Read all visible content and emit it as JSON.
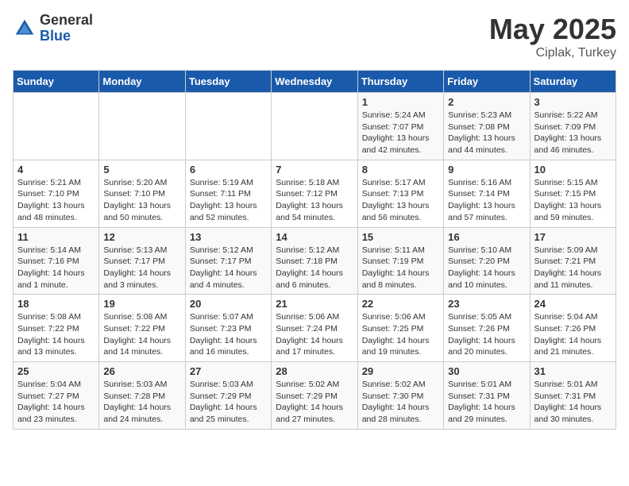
{
  "header": {
    "logo_general": "General",
    "logo_blue": "Blue",
    "title": "May 2025",
    "location": "Ciplak, Turkey"
  },
  "days_of_week": [
    "Sunday",
    "Monday",
    "Tuesday",
    "Wednesday",
    "Thursday",
    "Friday",
    "Saturday"
  ],
  "weeks": [
    [
      {
        "day": "",
        "info": ""
      },
      {
        "day": "",
        "info": ""
      },
      {
        "day": "",
        "info": ""
      },
      {
        "day": "",
        "info": ""
      },
      {
        "day": "1",
        "info": "Sunrise: 5:24 AM\nSunset: 7:07 PM\nDaylight: 13 hours\nand 42 minutes."
      },
      {
        "day": "2",
        "info": "Sunrise: 5:23 AM\nSunset: 7:08 PM\nDaylight: 13 hours\nand 44 minutes."
      },
      {
        "day": "3",
        "info": "Sunrise: 5:22 AM\nSunset: 7:09 PM\nDaylight: 13 hours\nand 46 minutes."
      }
    ],
    [
      {
        "day": "4",
        "info": "Sunrise: 5:21 AM\nSunset: 7:10 PM\nDaylight: 13 hours\nand 48 minutes."
      },
      {
        "day": "5",
        "info": "Sunrise: 5:20 AM\nSunset: 7:10 PM\nDaylight: 13 hours\nand 50 minutes."
      },
      {
        "day": "6",
        "info": "Sunrise: 5:19 AM\nSunset: 7:11 PM\nDaylight: 13 hours\nand 52 minutes."
      },
      {
        "day": "7",
        "info": "Sunrise: 5:18 AM\nSunset: 7:12 PM\nDaylight: 13 hours\nand 54 minutes."
      },
      {
        "day": "8",
        "info": "Sunrise: 5:17 AM\nSunset: 7:13 PM\nDaylight: 13 hours\nand 56 minutes."
      },
      {
        "day": "9",
        "info": "Sunrise: 5:16 AM\nSunset: 7:14 PM\nDaylight: 13 hours\nand 57 minutes."
      },
      {
        "day": "10",
        "info": "Sunrise: 5:15 AM\nSunset: 7:15 PM\nDaylight: 13 hours\nand 59 minutes."
      }
    ],
    [
      {
        "day": "11",
        "info": "Sunrise: 5:14 AM\nSunset: 7:16 PM\nDaylight: 14 hours\nand 1 minute."
      },
      {
        "day": "12",
        "info": "Sunrise: 5:13 AM\nSunset: 7:17 PM\nDaylight: 14 hours\nand 3 minutes."
      },
      {
        "day": "13",
        "info": "Sunrise: 5:12 AM\nSunset: 7:17 PM\nDaylight: 14 hours\nand 4 minutes."
      },
      {
        "day": "14",
        "info": "Sunrise: 5:12 AM\nSunset: 7:18 PM\nDaylight: 14 hours\nand 6 minutes."
      },
      {
        "day": "15",
        "info": "Sunrise: 5:11 AM\nSunset: 7:19 PM\nDaylight: 14 hours\nand 8 minutes."
      },
      {
        "day": "16",
        "info": "Sunrise: 5:10 AM\nSunset: 7:20 PM\nDaylight: 14 hours\nand 10 minutes."
      },
      {
        "day": "17",
        "info": "Sunrise: 5:09 AM\nSunset: 7:21 PM\nDaylight: 14 hours\nand 11 minutes."
      }
    ],
    [
      {
        "day": "18",
        "info": "Sunrise: 5:08 AM\nSunset: 7:22 PM\nDaylight: 14 hours\nand 13 minutes."
      },
      {
        "day": "19",
        "info": "Sunrise: 5:08 AM\nSunset: 7:22 PM\nDaylight: 14 hours\nand 14 minutes."
      },
      {
        "day": "20",
        "info": "Sunrise: 5:07 AM\nSunset: 7:23 PM\nDaylight: 14 hours\nand 16 minutes."
      },
      {
        "day": "21",
        "info": "Sunrise: 5:06 AM\nSunset: 7:24 PM\nDaylight: 14 hours\nand 17 minutes."
      },
      {
        "day": "22",
        "info": "Sunrise: 5:06 AM\nSunset: 7:25 PM\nDaylight: 14 hours\nand 19 minutes."
      },
      {
        "day": "23",
        "info": "Sunrise: 5:05 AM\nSunset: 7:26 PM\nDaylight: 14 hours\nand 20 minutes."
      },
      {
        "day": "24",
        "info": "Sunrise: 5:04 AM\nSunset: 7:26 PM\nDaylight: 14 hours\nand 21 minutes."
      }
    ],
    [
      {
        "day": "25",
        "info": "Sunrise: 5:04 AM\nSunset: 7:27 PM\nDaylight: 14 hours\nand 23 minutes."
      },
      {
        "day": "26",
        "info": "Sunrise: 5:03 AM\nSunset: 7:28 PM\nDaylight: 14 hours\nand 24 minutes."
      },
      {
        "day": "27",
        "info": "Sunrise: 5:03 AM\nSunset: 7:29 PM\nDaylight: 14 hours\nand 25 minutes."
      },
      {
        "day": "28",
        "info": "Sunrise: 5:02 AM\nSunset: 7:29 PM\nDaylight: 14 hours\nand 27 minutes."
      },
      {
        "day": "29",
        "info": "Sunrise: 5:02 AM\nSunset: 7:30 PM\nDaylight: 14 hours\nand 28 minutes."
      },
      {
        "day": "30",
        "info": "Sunrise: 5:01 AM\nSunset: 7:31 PM\nDaylight: 14 hours\nand 29 minutes."
      },
      {
        "day": "31",
        "info": "Sunrise: 5:01 AM\nSunset: 7:31 PM\nDaylight: 14 hours\nand 30 minutes."
      }
    ]
  ]
}
